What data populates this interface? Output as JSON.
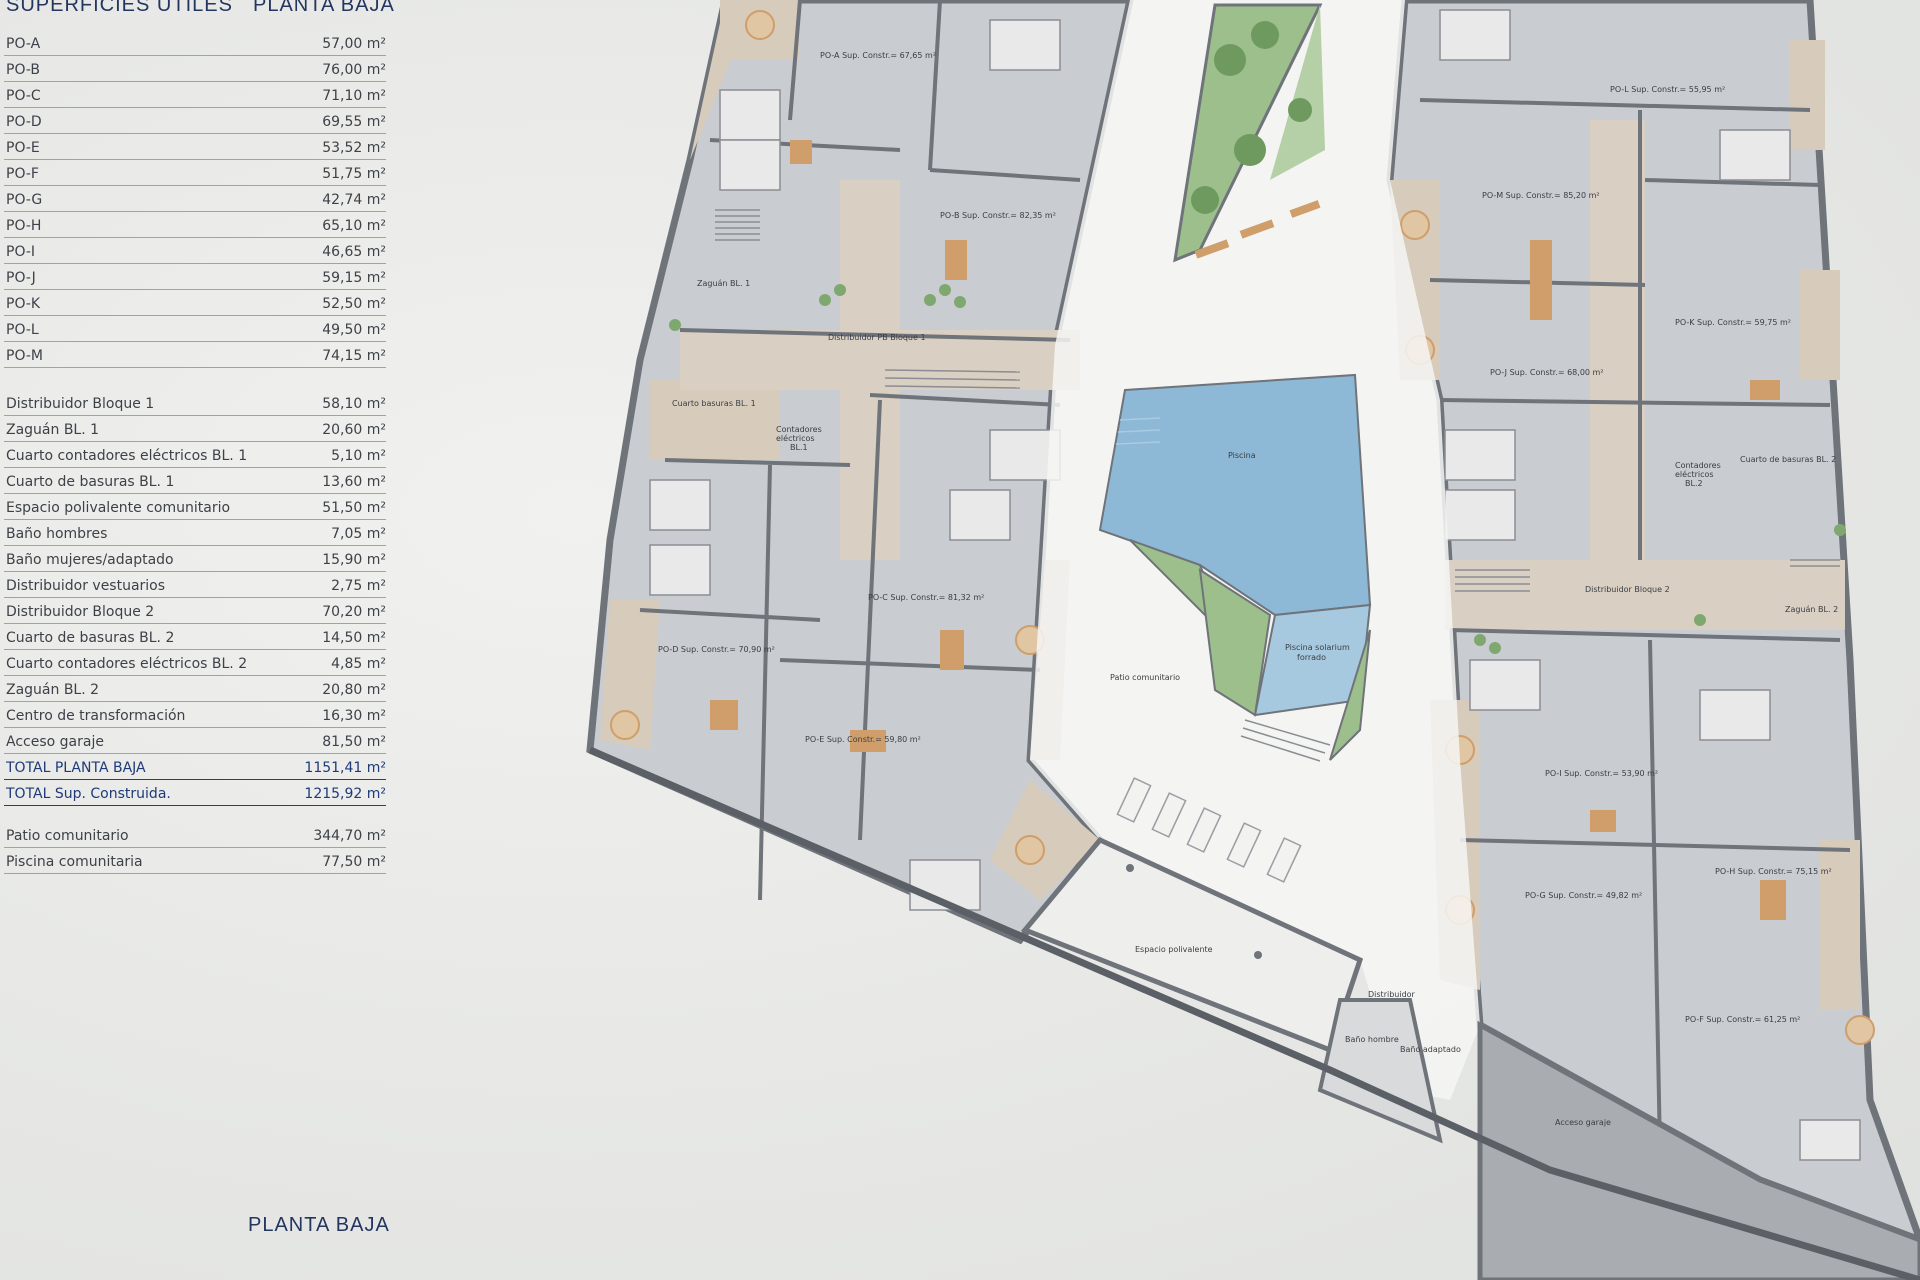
{
  "headers": {
    "left": "SUPERFICIES ÚTILES",
    "right": "PLANTA BAJA"
  },
  "units_table": [
    {
      "name": "PO-A",
      "value": "57,00 m²"
    },
    {
      "name": "PO-B",
      "value": "76,00 m²"
    },
    {
      "name": "PO-C",
      "value": "71,10 m²"
    },
    {
      "name": "PO-D",
      "value": "69,55 m²"
    },
    {
      "name": "PO-E",
      "value": "53,52 m²"
    },
    {
      "name": "PO-F",
      "value": "51,75 m²"
    },
    {
      "name": "PO-G",
      "value": "42,74 m²"
    },
    {
      "name": "PO-H",
      "value": "65,10 m²"
    },
    {
      "name": "PO-I",
      "value": "46,65 m²"
    },
    {
      "name": "PO-J",
      "value": "59,15 m²"
    },
    {
      "name": "PO-K",
      "value": "52,50 m²"
    },
    {
      "name": "PO-L",
      "value": "49,50 m²"
    },
    {
      "name": "PO-M",
      "value": "74,15 m²"
    }
  ],
  "common_table": [
    {
      "name": "Distribuidor Bloque 1",
      "value": "58,10 m²"
    },
    {
      "name": "Zaguán BL. 1",
      "value": "20,60 m²"
    },
    {
      "name": "Cuarto contadores eléctricos BL. 1",
      "value": "5,10 m²"
    },
    {
      "name": "Cuarto de basuras BL. 1",
      "value": "13,60 m²"
    },
    {
      "name": "Espacio polivalente comunitario",
      "value": "51,50 m²"
    },
    {
      "name": "Baño hombres",
      "value": "7,05 m²"
    },
    {
      "name": "Baño mujeres/adaptado",
      "value": "15,90 m²"
    },
    {
      "name": "Distribuidor vestuarios",
      "value": "2,75 m²"
    },
    {
      "name": "Distribuidor Bloque 2",
      "value": "70,20 m²"
    },
    {
      "name": "Cuarto de basuras BL. 2",
      "value": "14,50 m²"
    },
    {
      "name": "Cuarto contadores eléctricos BL. 2",
      "value": "4,85 m²"
    },
    {
      "name": "Zaguán BL. 2",
      "value": "20,80 m²"
    },
    {
      "name": "Centro de transformación",
      "value": "16,30 m²"
    },
    {
      "name": "Acceso garaje",
      "value": "81,50 m²"
    }
  ],
  "totals": [
    {
      "name": "TOTAL PLANTA BAJA",
      "value": "1151,41 m²"
    },
    {
      "name": "TOTAL Sup. Construida.",
      "value": "1215,92 m²"
    }
  ],
  "exterior_table": [
    {
      "name": "Patio comunitario",
      "value": "344,70 m²"
    },
    {
      "name": "Piscina comunitaria",
      "value": "77,50 m²"
    }
  ],
  "footer_title": "PLANTA BAJA",
  "plan_labels": {
    "po_a": "PO-A Sup. Constr.= 67,65 m²",
    "po_b": "PO-B Sup. Constr.= 82,35 m²",
    "po_c": "PO-C Sup. Constr.= 81,32 m²",
    "po_d": "PO-D Sup. Constr.= 70,90 m²",
    "po_e": "PO-E Sup. Constr.= 59,80 m²",
    "po_f": "PO-F Sup. Constr.= 61,25 m²",
    "po_g": "PO-G Sup. Constr.= 49,82 m²",
    "po_h": "PO-H Sup. Constr.= 75,15 m²",
    "po_i": "PO-I Sup. Constr.= 53,90 m²",
    "po_j": "PO-J Sup. Constr.= 68,00 m²",
    "po_k": "PO-K Sup. Constr.= 59,75 m²",
    "po_l": "PO-L Sup. Constr.= 55,95 m²",
    "po_m": "PO-M Sup. Constr.= 85,20 m²",
    "zaguan1": "Zaguán BL. 1",
    "distribuidor1": "Distribuidor PB Bloque 1",
    "basuras1": "Cuarto basuras BL. 1",
    "contadores1a": "Contadores",
    "contadores1b": "eléctricos",
    "contadores1c": "BL.1",
    "piscina": "Piscina",
    "piscina_solar": "Piscina solarium",
    "piscina_solar2": "forrado",
    "patio": "Patio comunitario",
    "espacio": "Espacio polivalente",
    "distribuidor_v": "Distribuidor",
    "bano_h": "Baño hombre",
    "bano_a": "Baño adaptado",
    "acceso": "Acceso garaje",
    "distribuidor2": "Distribuidor Bloque 2",
    "zaguan2": "Zaguán BL. 2",
    "basuras2": "Cuarto de basuras BL. 2",
    "contadores2a": "Contadores",
    "contadores2b": "eléctricos",
    "contadores2c": "BL.2"
  },
  "colors": {
    "title_blue": "#23365f",
    "total_blue": "#1e3a78",
    "pool": "#8db8d6",
    "wall": "#6f737a",
    "terrace": "#d7cbbb",
    "wood": "#cf9e6a",
    "green": "#7fa870"
  }
}
